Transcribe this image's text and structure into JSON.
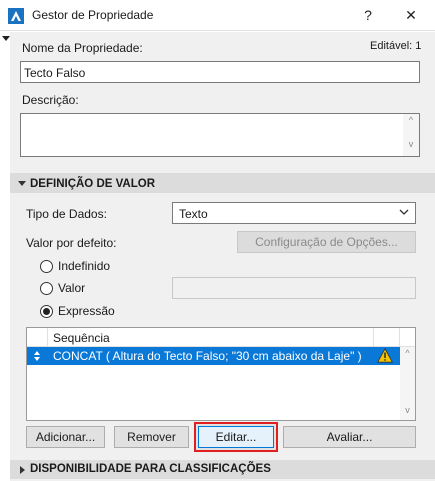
{
  "window": {
    "title": "Gestor de Propriedade",
    "help_label": "?",
    "close_label": "✕"
  },
  "header": {
    "editable_text": "Editável: 1"
  },
  "property_name": {
    "label": "Nome da Propriedade:",
    "value": "Tecto Falso"
  },
  "description": {
    "label": "Descrição:",
    "value": ""
  },
  "value_section": {
    "title": "DEFINIÇÃO DE VALOR"
  },
  "data_type": {
    "label": "Tipo de Dados:",
    "value": "Texto"
  },
  "default_value": {
    "label": "Valor por defeito:",
    "options_button": "Configuração de Opções..."
  },
  "radios": [
    {
      "label": "Indefinido",
      "selected": false
    },
    {
      "label": "Valor",
      "selected": false
    },
    {
      "label": "Expressão",
      "selected": true
    }
  ],
  "expression_list": {
    "column_header": "Sequência",
    "rows": [
      {
        "text": "CONCAT ( Altura do Tecto Falso; \"30 cm abaixo da Laje\" )",
        "warning": true
      }
    ]
  },
  "buttons": {
    "add": "Adicionar...",
    "remove": "Remover",
    "edit": "Editar...",
    "evaluate": "Avaliar..."
  },
  "availability_section": {
    "title": "DISPONIBILIDADE PARA CLASSIFICAÇÕES"
  },
  "colors": {
    "accent": "#0a78d7",
    "highlight_border": "#e02020",
    "warning": "#f5c400"
  }
}
